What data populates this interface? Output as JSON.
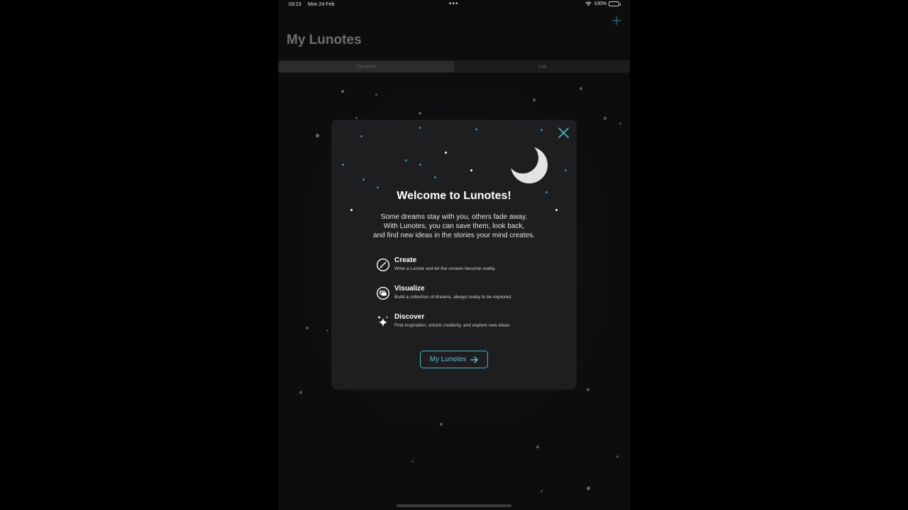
{
  "status_bar": {
    "time": "03:23",
    "date": "Mon 24 Feb",
    "dots": "•••",
    "battery": "100%"
  },
  "nav": {
    "title": "My Lunotes",
    "add_icon": "plus-icon"
  },
  "segmented_control": {
    "options": [
      "Dynamic",
      "List"
    ],
    "selected": "Dynamic"
  },
  "modal": {
    "close_icon": "close-icon",
    "moon_icon": "crescent-moon-icon",
    "title": "Welcome to Lunotes!",
    "body_lines": [
      "Some dreams stay with you, others fade away.",
      "With Lunotes, you can save them, look back,",
      "and find new ideas in the stories your mind creates."
    ],
    "features": [
      {
        "icon": "pencil-circle-icon",
        "title": "Create",
        "description": "Write a Lunote and let the unseen become reality."
      },
      {
        "icon": "photo-stack-circle-icon",
        "title": "Visualize",
        "description": "Build a collection of dreams, always ready to be explored."
      },
      {
        "icon": "sparkles-icon",
        "title": "Discover",
        "description": "Find inspiration, unlock creativity, and explore new ideas."
      }
    ],
    "cta_label": "My Lunotes",
    "cta_icon": "arrow-right-icon"
  },
  "colors": {
    "accent": "#4cb6cc",
    "background": "#0d0d0e",
    "modal_bg": "#1e1e20",
    "blue_star": "#3d86a8"
  }
}
